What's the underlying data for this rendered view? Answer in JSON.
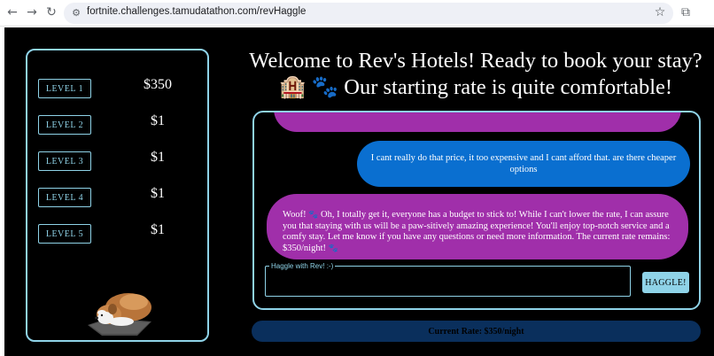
{
  "browser": {
    "url": "fortnite.challenges.tamudatathon.com/revHaggle",
    "back_icon": "←",
    "forward_icon": "→",
    "reload_icon": "↻",
    "site_info_icon": "⚙",
    "star_icon": "☆",
    "extensions_icon": "⧉"
  },
  "levels": [
    {
      "label": "LEVEL 1",
      "price": "$350"
    },
    {
      "label": "LEVEL 2",
      "price": "$1"
    },
    {
      "label": "LEVEL 3",
      "price": "$1"
    },
    {
      "label": "LEVEL 4",
      "price": "$1"
    },
    {
      "label": "LEVEL 5",
      "price": "$1"
    }
  ],
  "header": {
    "line1": "Welcome to Rev's Hotels! Ready to book your stay?",
    "hotel_emoji": "🏨",
    "paw_emoji": "🐾",
    "line2": "Our starting rate is quite comfortable!"
  },
  "chat": {
    "user_message": "I cant really do that price, it too expensive and I cant afford that. are there cheaper options",
    "bot_message_part1": "Woof!",
    "bot_message_paw": "🐾",
    "bot_message_part2": "Oh, I totally get it, everyone has a budget to stick to! While I can't lower the rate, I can assure you that staying with us will be a paw-sitively amazing experience! You'll enjoy top-notch service and a comfy stay. Let me know if you have any questions or need more information. The current rate remains: $350/night!"
  },
  "haggle": {
    "legend": "Haggle with Rev! :-)",
    "value": "",
    "button_label": "HAGGLE!"
  },
  "status": {
    "current_rate": "Current Rate: $350/night"
  },
  "colors": {
    "accent": "#8fd3e8",
    "user_bubble": "#0a6fd0",
    "bot_bubble": "#a02faa",
    "rate_bar": "#0a2f5c"
  }
}
